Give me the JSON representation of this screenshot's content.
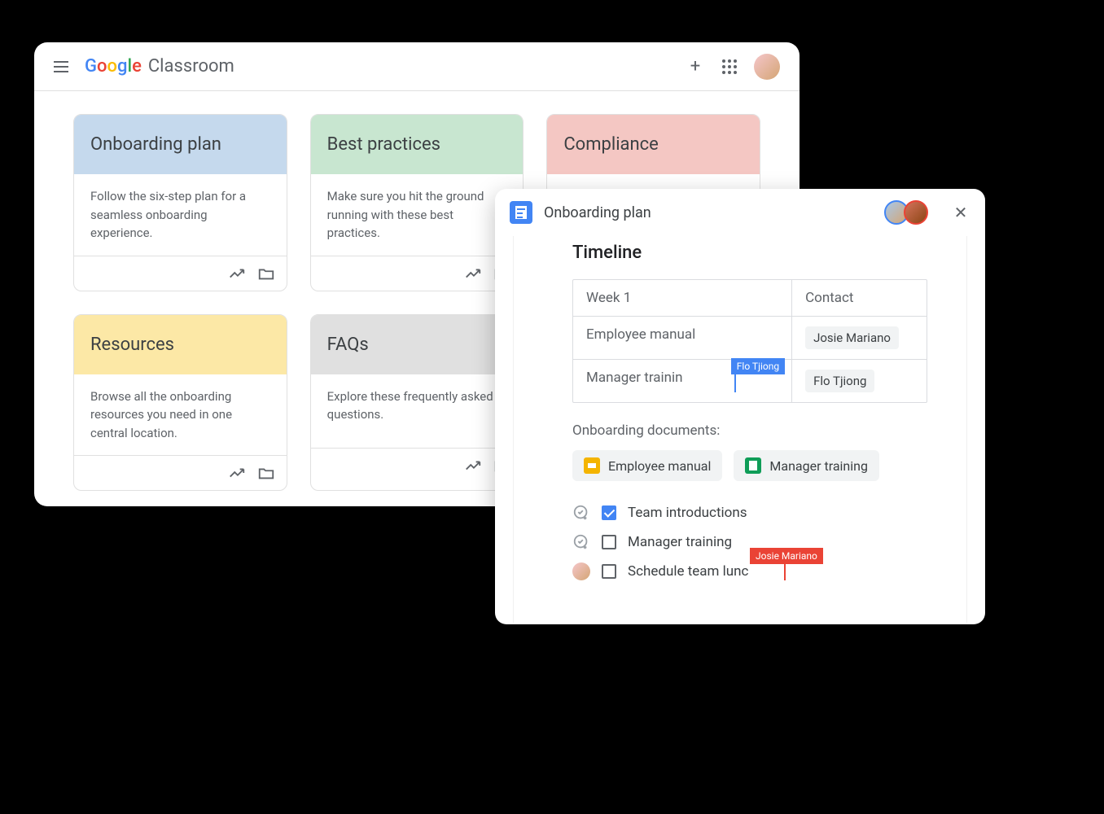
{
  "header": {
    "app_name": "Classroom"
  },
  "cards": [
    {
      "title": "Onboarding plan",
      "desc": "Follow the six-step plan for a seamless onboarding experience.",
      "color": "blue"
    },
    {
      "title": "Best practices",
      "desc": "Make sure you hit the ground running with these best practices.",
      "color": "green"
    },
    {
      "title": "Compliance",
      "desc": "",
      "color": "pink"
    },
    {
      "title": "Resources",
      "desc": "Browse all the onboarding resources you need in one central location.",
      "color": "yellow"
    },
    {
      "title": "FAQs",
      "desc": "Explore these frequently asked questions.",
      "color": "gray"
    }
  ],
  "docs": {
    "title": "Onboarding plan",
    "heading": "Timeline",
    "table": {
      "headers": [
        "Week 1",
        "Contact"
      ],
      "rows": [
        {
          "task": "Employee manual",
          "contact": "Josie Mariano"
        },
        {
          "task": "Manager trainin",
          "contact": "Flo Tjiong"
        }
      ]
    },
    "cursor1_label": "Flo Tjiong",
    "docs_label": "Onboarding documents:",
    "attachments": [
      {
        "type": "slides",
        "name": "Employee manual"
      },
      {
        "type": "sheets",
        "name": "Manager training"
      }
    ],
    "checklist": [
      {
        "label": "Team introductions",
        "checked": true,
        "icon": "check-add"
      },
      {
        "label": "Manager training",
        "checked": false,
        "icon": "check-add"
      },
      {
        "label": "Schedule team lunc",
        "checked": false,
        "icon": "avatar"
      }
    ],
    "cursor2_label": "Josie Mariano"
  }
}
